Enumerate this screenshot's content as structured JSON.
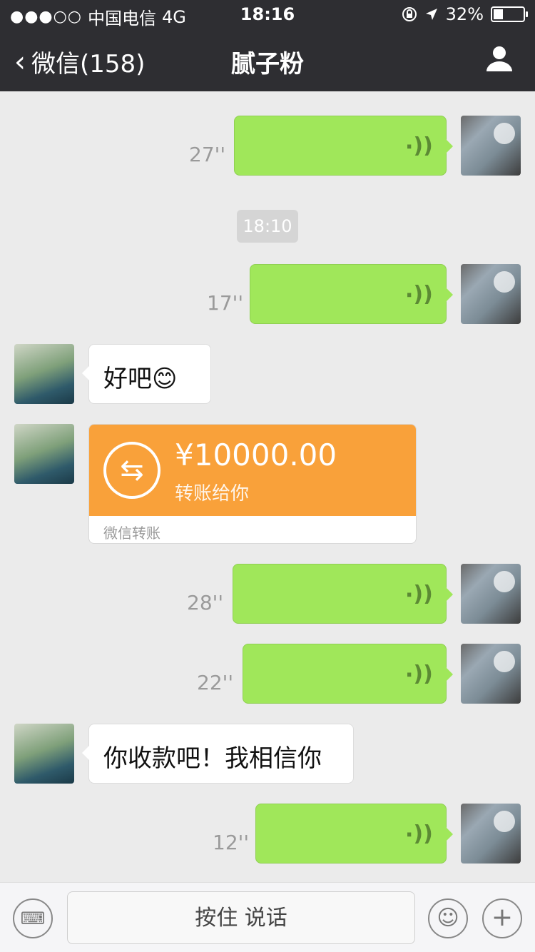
{
  "status_bar": {
    "signal_dots": "●●●○○",
    "carrier": "中国电信",
    "network": "4G",
    "time": "18:16",
    "battery_pct": "32%",
    "battery_level": 0.32
  },
  "nav": {
    "back_label": "微信(158)",
    "chat_title": "腻子粉"
  },
  "messages": {
    "voice1_duration": "27''",
    "timestamp": "18:10",
    "voice2_duration": "17''",
    "text1": "好吧😊",
    "transfer": {
      "amount": "¥10000.00",
      "desc": "转账给你",
      "footer": "微信转账"
    },
    "voice3_duration": "28''",
    "voice4_duration": "22''",
    "text2": "你收款吧！我相信你",
    "voice5_duration": "12''"
  },
  "input_bar": {
    "hold_to_talk": "按住 说话"
  },
  "icons": {
    "voice_wave": "((·"
  },
  "colors": {
    "header_bg": "#2e2e32",
    "voice_bubble": "#a0e75a",
    "transfer": "#f9a13a"
  }
}
